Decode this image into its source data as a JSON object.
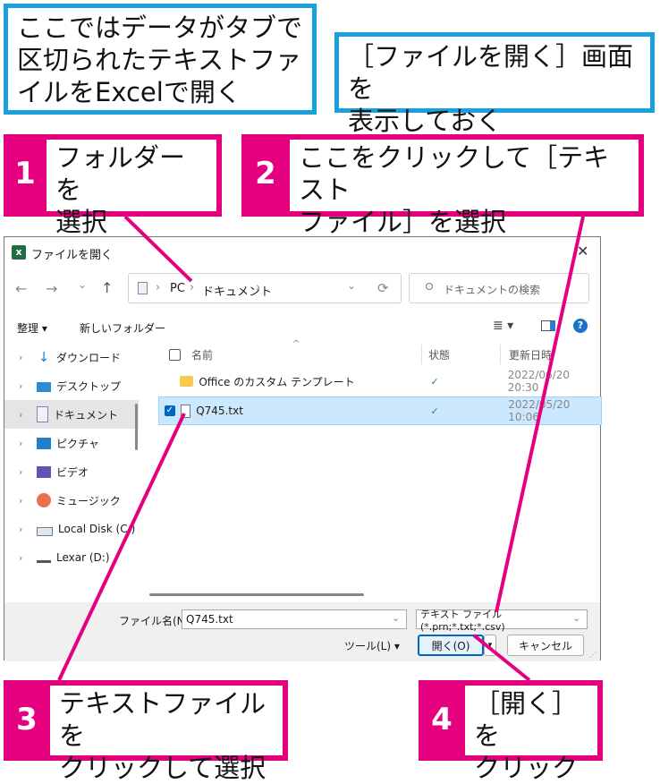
{
  "callouts": {
    "intro": "ここではデータがタブで区切られたテキストファイルをExcelで開く",
    "intro_lines": [
      "ここではデータがタブで",
      "区切られたテキストファ",
      "イルをExcelで開く"
    ],
    "goal_lines": [
      "［ファイルを開く］画面を",
      "表示しておく"
    ],
    "steps": [
      {
        "num": "1",
        "lines": [
          "フォルダーを",
          "選択"
        ]
      },
      {
        "num": "2",
        "lines": [
          "ここをクリックして［テキスト",
          "ファイル］を選択"
        ]
      },
      {
        "num": "3",
        "lines": [
          "テキストファイルを",
          "クリックして選択"
        ]
      },
      {
        "num": "4",
        "lines": [
          "［開く］を",
          "クリック"
        ]
      }
    ]
  },
  "colors": {
    "accent": "#e5007f",
    "note_border": "#1aa0dc",
    "selection": "#cce8ff",
    "primary_button": "#0067c0"
  },
  "dialog": {
    "title": "ファイルを開く",
    "app_icon": "excel-icon",
    "close_glyph": "✕",
    "nav": {
      "back": "←",
      "forward": "→",
      "recent": "⌄",
      "up": "↑",
      "refresh": "⟳"
    },
    "breadcrumb": {
      "root": "PC",
      "sep": "›",
      "folder": "ドキュメント"
    },
    "search_placeholder": "ドキュメントの検索",
    "toolbar": {
      "organize": "整理 ▾",
      "new_folder": "新しいフォルダー",
      "view_glyph": "≣ ▾",
      "help": "?"
    },
    "sidebar": [
      {
        "label": "ダウンロード",
        "icon": "download-icon"
      },
      {
        "label": "デスクトップ",
        "icon": "desktop-icon"
      },
      {
        "label": "ドキュメント",
        "icon": "documents-icon",
        "selected": true
      },
      {
        "label": "ピクチャ",
        "icon": "pictures-icon"
      },
      {
        "label": "ビデオ",
        "icon": "videos-icon"
      },
      {
        "label": "ミュージック",
        "icon": "music-icon"
      },
      {
        "label": "Local Disk (C:)",
        "icon": "drive-icon"
      },
      {
        "label": "Lexar (D:)",
        "icon": "usb-drive-icon"
      }
    ],
    "columns": {
      "name": "名前",
      "status": "状態",
      "modified": "更新日時"
    },
    "files": [
      {
        "name": "Office のカスタム テンプレート",
        "type": "folder",
        "status": "✓",
        "modified": "2022/06/20 20:30"
      },
      {
        "name": "Q745.txt",
        "type": "text",
        "status": "✓",
        "modified": "2022/05/20 10:06",
        "selected": true
      }
    ],
    "filename_label": "ファイル名(N):",
    "filename_value": "Q745.txt",
    "filetype_value": "テキスト ファイル (*.prn;*.txt;*.csv)",
    "tools_label": "ツール(L)  ▾",
    "open_button": "開く(O)",
    "cancel_button": "キャンセル"
  }
}
